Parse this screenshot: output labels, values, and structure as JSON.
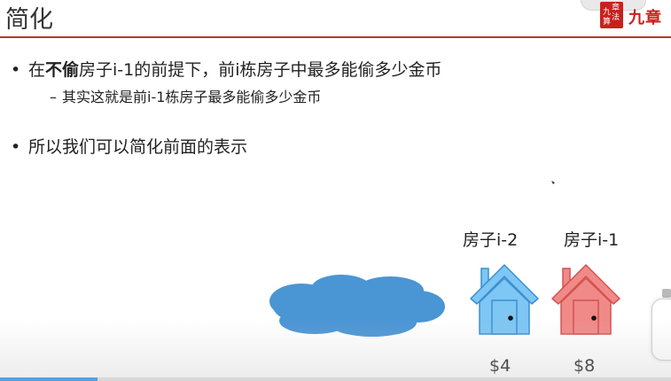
{
  "slide": {
    "title": "简化",
    "brand": {
      "seal_text": [
        "章",
        "法",
        "九",
        "算"
      ],
      "name": "九章"
    },
    "bullets": [
      {
        "pre": "在",
        "bold": "不偷",
        "post": "房子i-1的前提下，前i栋房子中最多能偷多少金币"
      },
      {
        "pre": "所以我们可以简化前面的表示",
        "bold": "",
        "post": ""
      }
    ],
    "sub_bullets": [
      {
        "dash": "–",
        "text": "其实这就是前i-1栋房子最多能偷多少金币"
      }
    ],
    "houses": [
      {
        "label": "房子i-2",
        "price": "$4",
        "color": "#7ec6f3",
        "stroke": "#3a8fd0"
      },
      {
        "label": "房子i-1",
        "price": "$8",
        "color": "#f08a88",
        "stroke": "#d2524f"
      }
    ],
    "cloud_color": "#4a95d4"
  },
  "player": {
    "progress_percent": 14.5
  }
}
